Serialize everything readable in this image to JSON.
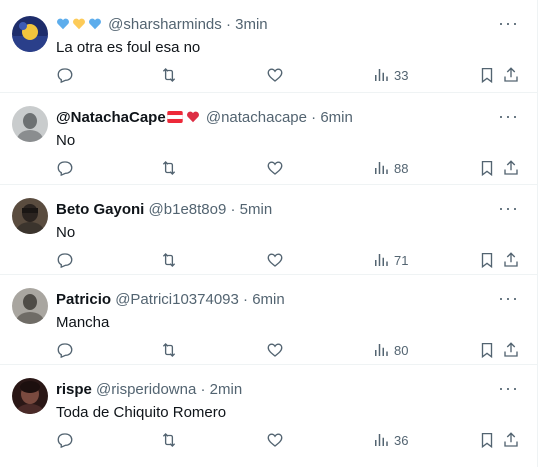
{
  "posts": [
    {
      "name": "",
      "name_emojis": [
        "blue-heart",
        "yellow-heart",
        "blue-heart"
      ],
      "handle": "@sharsharminds",
      "dot": "·",
      "time": "3min",
      "text": "La otra es foul esa no",
      "views": "33",
      "avatar_color": "#1e2d6b"
    },
    {
      "name": "@NatachaCape",
      "name_emojis_after": [
        "flag-austria",
        "red-heart"
      ],
      "handle": "@natachacape",
      "dot": "·",
      "time": "6min",
      "text": "No",
      "views": "88",
      "avatar_color": "#9aa0a3"
    },
    {
      "name": "Beto Gayoni",
      "handle": "@b1e8t8o9",
      "dot": "·",
      "time": "5min",
      "text": "No",
      "views": "71",
      "avatar_color": "#3b342d"
    },
    {
      "name": "Patricio",
      "handle": "@Patrici10374093",
      "dot": "·",
      "time": "6min",
      "text": "Mancha",
      "views": "80",
      "avatar_color": "#6f6c66"
    },
    {
      "name": "rispe",
      "handle": "@risperidowna",
      "dot": "·",
      "time": "2min",
      "text": "Toda de Chiquito Romero",
      "views": "36",
      "avatar_color": "#4a2a28"
    }
  ],
  "colors": {
    "text": "#0f1419",
    "muted": "#536471",
    "border": "#eff3f4",
    "heart_red": "#dd2e44",
    "heart_blue": "#5dadec",
    "heart_yellow": "#fdcb58"
  }
}
